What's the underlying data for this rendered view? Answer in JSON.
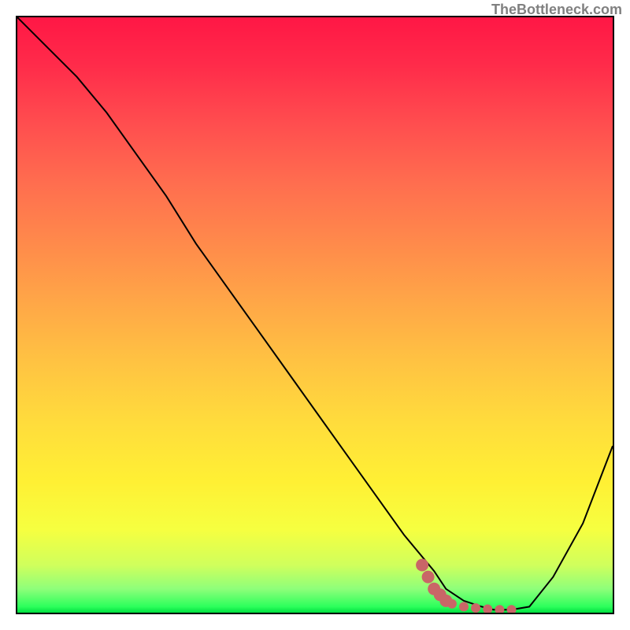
{
  "watermark": "TheBottleneck.com",
  "chart_data": {
    "type": "line",
    "title": "",
    "xlabel": "",
    "ylabel": "",
    "xlim": [
      0,
      100
    ],
    "ylim": [
      0,
      100
    ],
    "grid": false,
    "series": [
      {
        "name": "bottleneck-curve",
        "color": "#000000",
        "x": [
          0,
          5,
          10,
          15,
          20,
          25,
          30,
          35,
          40,
          45,
          50,
          55,
          60,
          65,
          70,
          72,
          75,
          78,
          80,
          83,
          86,
          90,
          95,
          100
        ],
        "y": [
          100,
          95,
          90,
          84,
          77,
          70,
          62,
          55,
          48,
          41,
          34,
          27,
          20,
          13,
          7,
          4,
          2,
          1,
          0.5,
          0.5,
          1,
          6,
          15,
          28
        ]
      }
    ],
    "markers": {
      "name": "optimal-range",
      "color": "#c96667",
      "points": [
        {
          "x": 68,
          "y": 8
        },
        {
          "x": 69,
          "y": 6
        },
        {
          "x": 70,
          "y": 4
        },
        {
          "x": 71,
          "y": 3
        },
        {
          "x": 72,
          "y": 2
        },
        {
          "x": 73,
          "y": 1.5
        },
        {
          "x": 75,
          "y": 1
        },
        {
          "x": 77,
          "y": 0.8
        },
        {
          "x": 79,
          "y": 0.6
        },
        {
          "x": 81,
          "y": 0.5
        },
        {
          "x": 83,
          "y": 0.5
        }
      ]
    },
    "gradient_stops": [
      {
        "pos": 0,
        "color": "#ff1745"
      },
      {
        "pos": 50,
        "color": "#ffb045"
      },
      {
        "pos": 80,
        "color": "#fff034"
      },
      {
        "pos": 100,
        "color": "#00e040"
      }
    ]
  }
}
